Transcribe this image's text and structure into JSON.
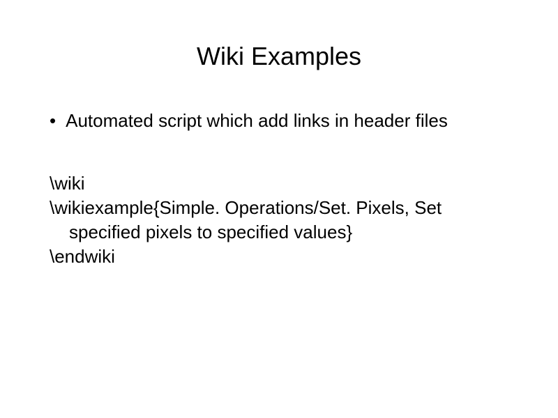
{
  "title": "Wiki Examples",
  "bullet": {
    "marker": "•",
    "text": " Automated script which add links in header files"
  },
  "code": {
    "line1": "\\wiki",
    "line2": "\\wikiexample{Simple. Operations/Set. Pixels, Set",
    "line3": "specified pixels to specified values}",
    "line4": "\\endwiki"
  }
}
